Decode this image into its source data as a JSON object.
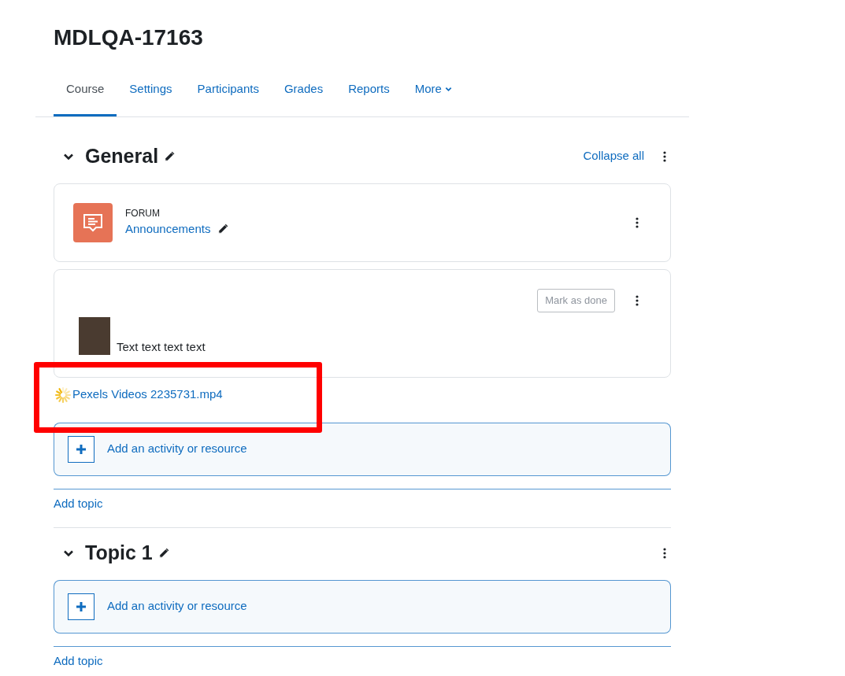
{
  "course_title": "MDLQA-17163",
  "tabs": [
    {
      "label": "Course",
      "selected": true
    },
    {
      "label": "Settings",
      "selected": false
    },
    {
      "label": "Participants",
      "selected": false
    },
    {
      "label": "Grades",
      "selected": false
    },
    {
      "label": "Reports",
      "selected": false
    },
    {
      "label": "More",
      "selected": false,
      "dropdown": true
    }
  ],
  "sections": [
    {
      "title": "General",
      "expanded": true,
      "collapse_all": "Collapse all",
      "activities": [
        {
          "kind": "forum",
          "type_label": "FORUM",
          "name": "Announcements"
        },
        {
          "kind": "label",
          "button": "Mark as done",
          "text": "Text text text text"
        }
      ],
      "uploading": {
        "name": "Pexels Videos 2235731.mp4",
        "highlighted": true
      },
      "add_activity": "Add an activity or resource",
      "add_topic": "Add topic"
    },
    {
      "title": "Topic 1",
      "expanded": true,
      "add_activity": "Add an activity or resource",
      "add_topic": "Add topic"
    }
  ]
}
